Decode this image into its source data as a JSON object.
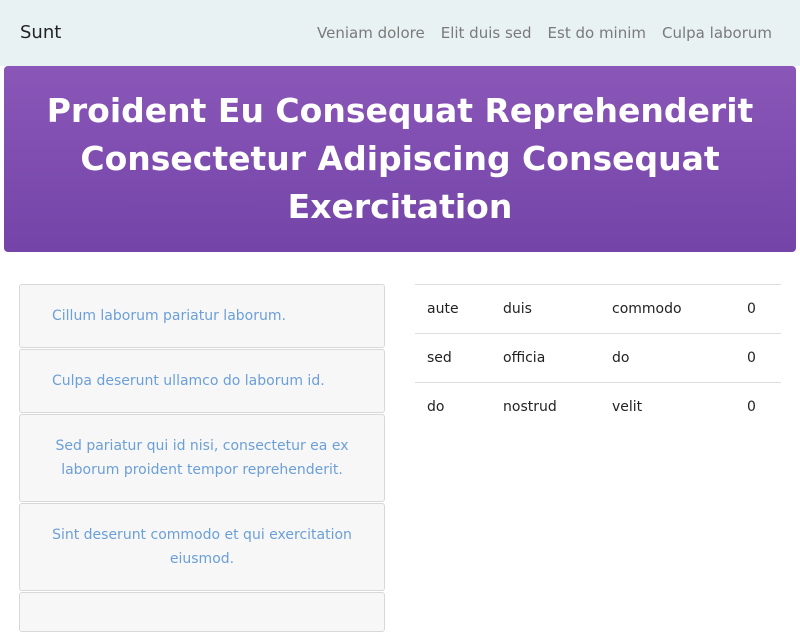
{
  "navbar": {
    "brand": "Sunt",
    "links": [
      "Veniam dolore",
      "Elit duis sed",
      "Est do minim",
      "Culpa laborum"
    ]
  },
  "hero": {
    "title": "Proident Eu Consequat Reprehenderit Consectetur Adipiscing Consequat Exercitation"
  },
  "list": {
    "items": [
      "Cillum laborum pariatur laborum.",
      "Culpa deserunt ullamco do laborum id.",
      "Sed pariatur qui id nisi, consectetur ea ex laborum proident tempor reprehenderit.",
      "Sint deserunt commodo et qui exercitation eiusmod."
    ]
  },
  "table": {
    "rows": [
      [
        "aute",
        "duis",
        "commodo",
        "0"
      ],
      [
        "sed",
        "officia",
        "do",
        "0"
      ],
      [
        "do",
        "nostrud",
        "velit",
        "0"
      ]
    ]
  },
  "colors": {
    "navbar_bg": "#e8f2f2",
    "hero_bg": "#7e4eb2",
    "link": "#6b9fd8"
  }
}
